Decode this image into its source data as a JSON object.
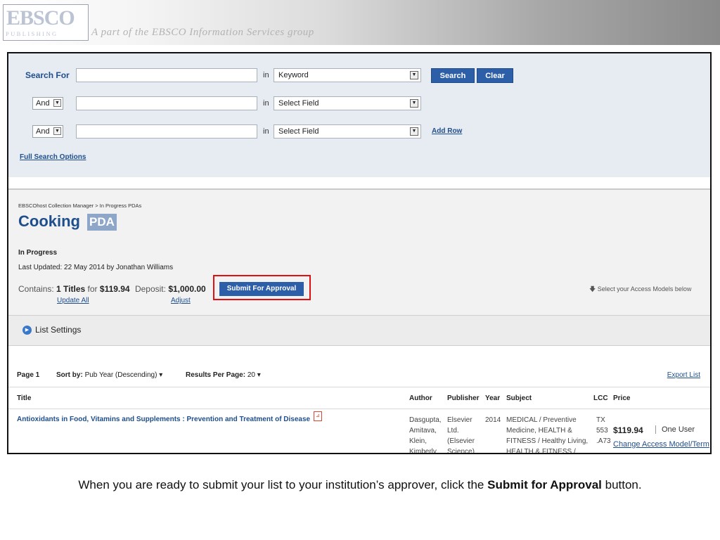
{
  "banner": {
    "logo_word": "EBSCO",
    "logo_sub": "PUBLISHING",
    "tagline": "A part of the EBSCO Information Services group"
  },
  "search": {
    "label": "Search For",
    "in_word": "in",
    "row1": {
      "query": "",
      "field": "Keyword"
    },
    "row2": {
      "bool": "And",
      "query": "",
      "field": "Select Field"
    },
    "row3": {
      "bool": "And",
      "query": "",
      "field": "Select Field"
    },
    "search_button": "Search",
    "clear_button": "Clear",
    "add_row": "Add Row",
    "full_options": "Full Search Options"
  },
  "breadcrumb": "EBSCOhost Collection Manager  >  In Progress PDAs",
  "page": {
    "title": "Cooking",
    "badge": "PDA",
    "status": "In Progress",
    "last_updated": "Last Updated: 22 May 2014 by Jonathan Williams"
  },
  "summary": {
    "contains_label": "Contains:",
    "titles": "1 Titles",
    "for_word": "for",
    "amount": "$119.94",
    "deposit_label": "Deposit:",
    "deposit": "$1,000.00",
    "update_all": "Update All",
    "adjust": "Adjust",
    "submit_button": "Submit For Approval",
    "access_hint": "Select your Access Models below"
  },
  "settings": {
    "label": "List Settings"
  },
  "pager": {
    "page": "Page 1",
    "sort_label": "Sort by:",
    "sort_value": "Pub Year (Descending) ▾",
    "per_page_label": "Results Per Page:",
    "per_page_value": "20 ▾",
    "export": "Export List"
  },
  "table": {
    "headers": [
      "Title",
      "Author",
      "Publisher",
      "Year",
      "Subject",
      "LCC",
      "Price"
    ],
    "rows": [
      {
        "title": "Antioxidants in Food, Vitamins and Supplements : Prevention and Treatment of Disease",
        "author": [
          "Dasgupta,",
          "Amitava,",
          "Klein,",
          "Kimberly"
        ],
        "publisher": [
          "Elsevier",
          "Ltd.",
          "(Elsevier",
          "Science)"
        ],
        "year": "2014",
        "subject": [
          "MEDICAL / Preventive",
          "Medicine, HEALTH &",
          "FITNESS / Healthy Living,",
          "HEALTH & FITNESS /"
        ],
        "lcc": [
          "TX",
          "553",
          ".A73"
        ],
        "price": "$119.94",
        "user": "One User",
        "change_link": "Change Access Model/Term"
      }
    ]
  },
  "caption": {
    "before": "When you are ready to submit your list to your institution’s approver, click the ",
    "bold": "Submit for Approval",
    "after": " button."
  }
}
